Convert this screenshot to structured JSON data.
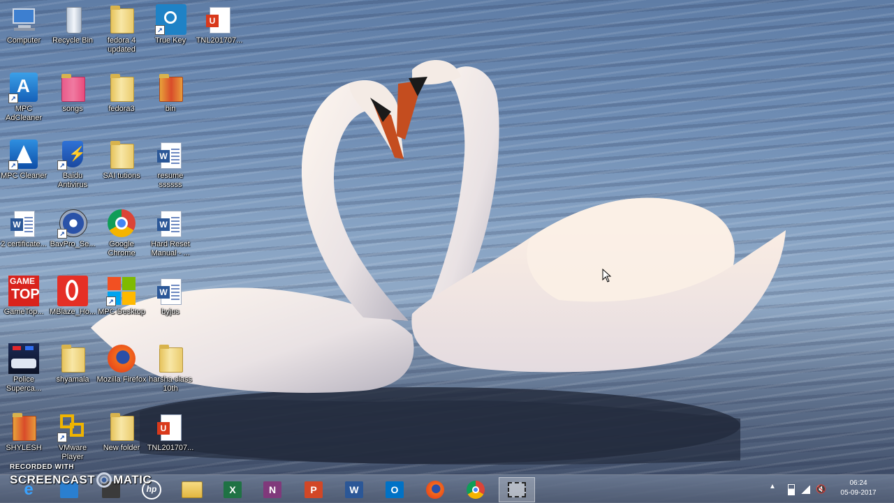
{
  "desktop": {
    "icons": [
      {
        "label": "Computer",
        "icon": "computer-icon"
      },
      {
        "label": "Recycle Bin",
        "icon": "recycle-bin-icon"
      },
      {
        "label": "fedora 4 updated",
        "icon": "folder-icon"
      },
      {
        "label": "True Key",
        "icon": "true-key-icon"
      },
      {
        "label": "TNL201707...",
        "icon": "pdf-document-icon"
      },
      {
        "label": "MPC AdCleaner",
        "icon": "mpc-adcleaner-icon"
      },
      {
        "label": "songs",
        "icon": "folder-icon"
      },
      {
        "label": "fedora3",
        "icon": "folder-icon"
      },
      {
        "label": "bin",
        "icon": "folder-icon"
      },
      {
        "label": "MPC Cleaner",
        "icon": "mpc-cleaner-icon"
      },
      {
        "label": "Baidu Antivirus",
        "icon": "baidu-antivirus-icon"
      },
      {
        "label": "SAI tutions",
        "icon": "folder-icon"
      },
      {
        "label": "resume ssssss",
        "icon": "word-document-icon"
      },
      {
        "label": "2 certificate...",
        "icon": "word-document-icon"
      },
      {
        "label": "BavPro_Se...",
        "icon": "bavpro-icon"
      },
      {
        "label": "Google Chrome",
        "icon": "chrome-icon"
      },
      {
        "label": "Hard Reset Manual - ...",
        "icon": "word-document-icon"
      },
      {
        "label": "GameTop...",
        "icon": "gametop-icon"
      },
      {
        "label": "MBlaze_Ho...",
        "icon": "mblaze-icon"
      },
      {
        "label": "MPC Desktop",
        "icon": "mpc-desktop-icon"
      },
      {
        "label": "byjus",
        "icon": "word-document-icon"
      },
      {
        "label": "Police Superca...",
        "icon": "police-game-icon"
      },
      {
        "label": "shyamala",
        "icon": "folder-icon"
      },
      {
        "label": "Mozilla Firefox",
        "icon": "firefox-icon"
      },
      {
        "label": "harsha class 10th",
        "icon": "folder-icon"
      },
      {
        "label": "SHYLESH",
        "icon": "folder-icon"
      },
      {
        "label": "VMware Player",
        "icon": "vmware-icon"
      },
      {
        "label": "New folder",
        "icon": "folder-icon"
      },
      {
        "label": "TNL201707...",
        "icon": "pdf-document-icon"
      }
    ]
  },
  "watermark": {
    "recorded_with": "RECORDED WITH",
    "brand_left": "SCREENCAST",
    "brand_right": "MATIC"
  },
  "taskbar": {
    "pinned": [
      {
        "name": "ie",
        "icon": "internet-explorer-icon",
        "glyph": "e"
      },
      {
        "name": "hp",
        "icon": "hp-icon",
        "glyph": "hp"
      },
      {
        "name": "explorer",
        "icon": "file-explorer-icon",
        "glyph": ""
      },
      {
        "name": "excel",
        "icon": "excel-icon",
        "glyph": "X"
      },
      {
        "name": "onenote",
        "icon": "onenote-icon",
        "glyph": "N"
      },
      {
        "name": "powerpoint",
        "icon": "powerpoint-icon",
        "glyph": "P"
      },
      {
        "name": "word",
        "icon": "word-icon",
        "glyph": "W"
      },
      {
        "name": "outlook",
        "icon": "outlook-icon",
        "glyph": "O"
      },
      {
        "name": "firefox",
        "icon": "firefox-icon",
        "glyph": ""
      },
      {
        "name": "chrome",
        "icon": "chrome-icon",
        "glyph": ""
      },
      {
        "name": "snipping",
        "icon": "snipping-tool-icon",
        "glyph": ""
      }
    ],
    "tray": {
      "time": "06:24",
      "date": "05-09-2017"
    }
  },
  "colors": {
    "excel": "#1f7244",
    "onenote": "#80397b",
    "powerpoint": "#d24726",
    "word": "#2b5797",
    "outlook": "#0072c6"
  }
}
